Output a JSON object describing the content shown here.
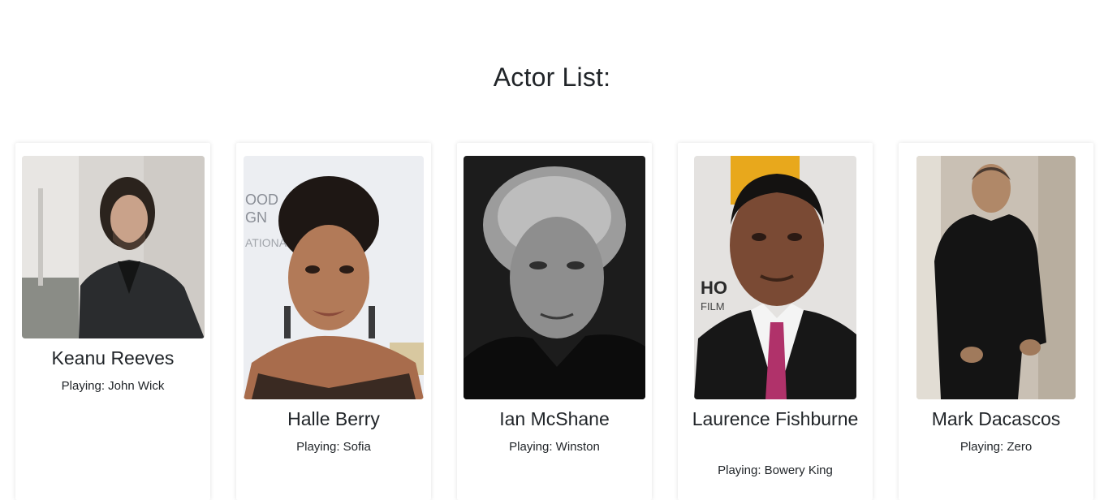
{
  "page": {
    "title": "Actor List:"
  },
  "actors": [
    {
      "name": "Keanu Reeves",
      "role_prefix": "Playing:",
      "role": "John Wick",
      "role_text": "Playing: John Wick"
    },
    {
      "name": "Halle Berry",
      "role_prefix": "Playing:",
      "role": "Sofia",
      "role_text": "Playing: Sofia"
    },
    {
      "name": "Ian McShane",
      "role_prefix": "Playing:",
      "role": "Winston",
      "role_text": "Playing: Winston"
    },
    {
      "name": "Laurence Fishburne",
      "role_prefix": "Playing:",
      "role": "Bowery King",
      "role_text": "Playing: Bowery King"
    },
    {
      "name": "Mark Dacascos",
      "role_prefix": "Playing:",
      "role": "Zero",
      "role_text": "Playing: Zero"
    }
  ]
}
